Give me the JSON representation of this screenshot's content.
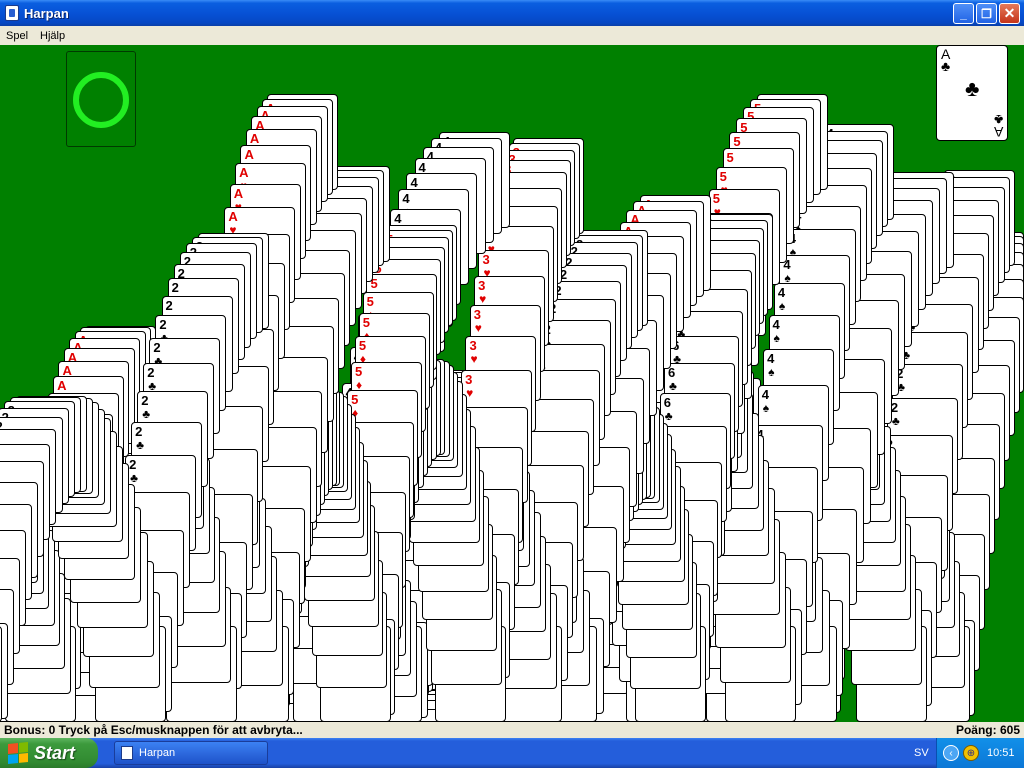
{
  "window": {
    "title": "Harpan",
    "min_label": "_",
    "max_label": "❐",
    "close_label": "✕"
  },
  "menu": {
    "items": [
      {
        "label": "Spel"
      },
      {
        "label": "Hjälp"
      }
    ]
  },
  "status": {
    "left": "Bonus: 0  Tryck på Esc/musknappen för att avbryta...",
    "right": "Poäng: 605"
  },
  "foundation_card": {
    "rank": "A",
    "suit": "♣"
  },
  "cascade": {
    "ranks": [
      "A",
      "2",
      "3",
      "4",
      "5",
      "6"
    ],
    "suits": [
      "♥",
      "♣",
      "♦",
      "♠"
    ],
    "colors": {
      "red": "#e00000",
      "black": "#000000",
      "felt": "#008000",
      "ring": "#22ee22"
    }
  },
  "taskbar": {
    "start_label": "Start",
    "task_label": "Harpan",
    "language": "SV",
    "clock": "10:51",
    "tray_arrow": "‹",
    "globe_glyph": "⊕"
  }
}
